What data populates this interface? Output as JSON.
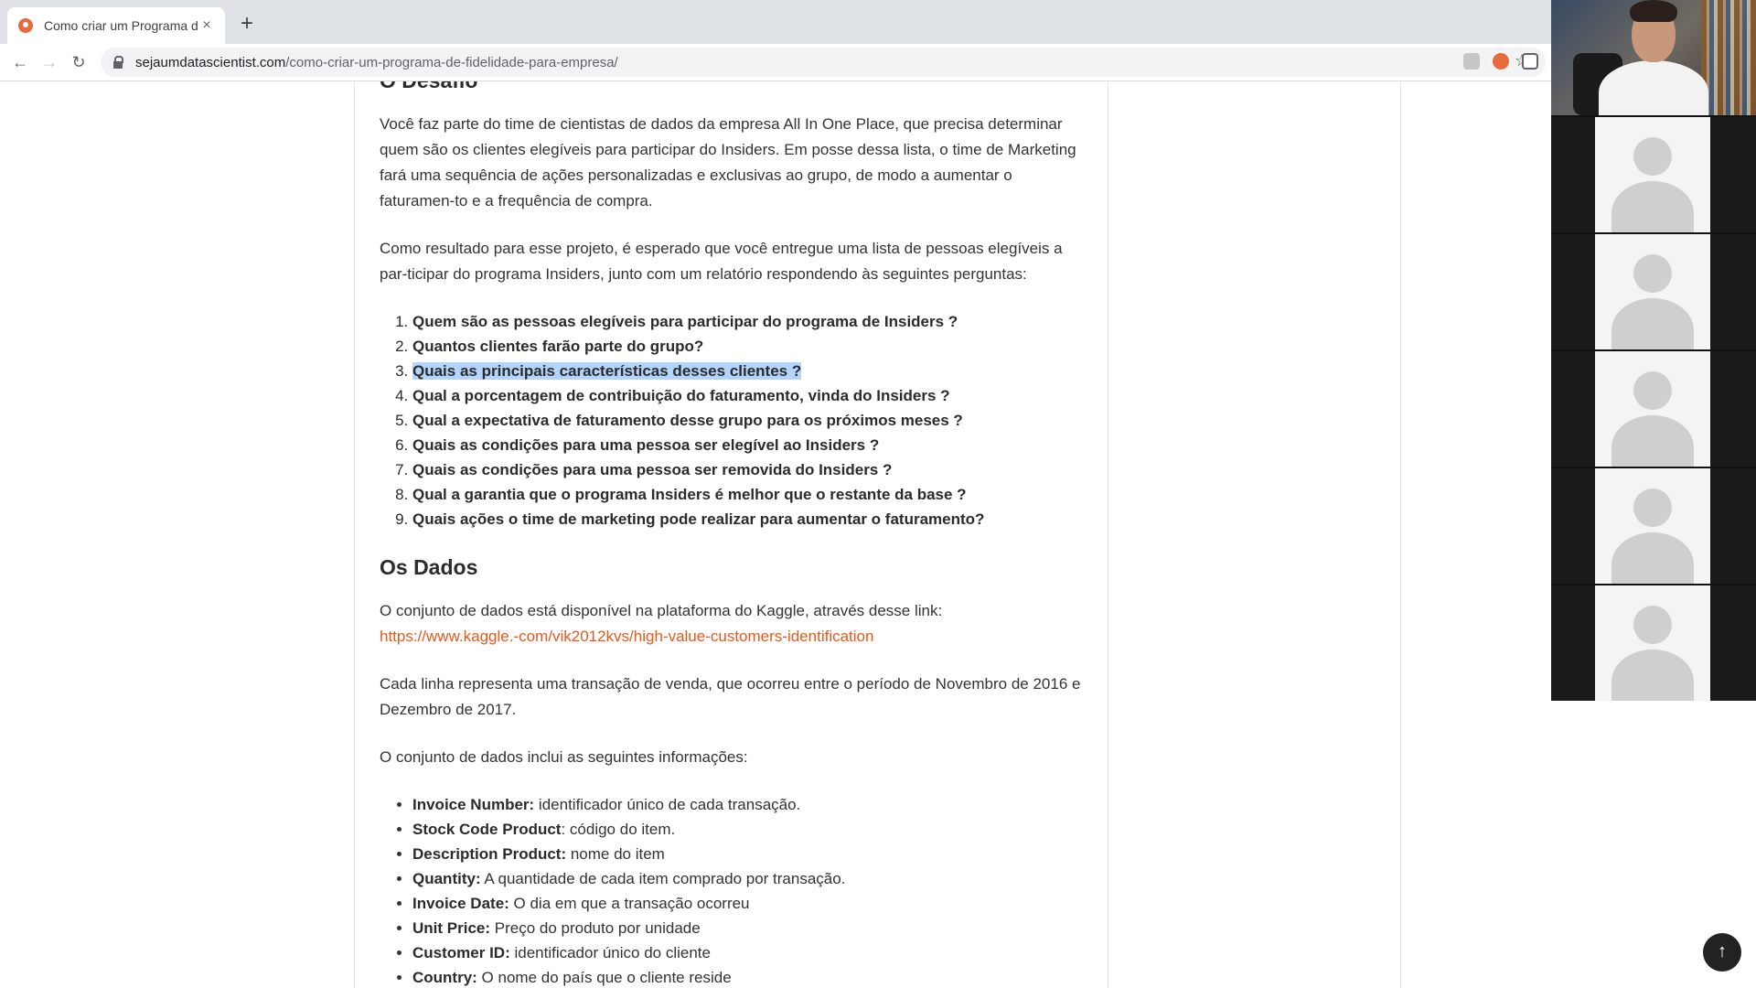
{
  "browser": {
    "tab_title": "Como criar um Programa de Fi",
    "tab_close": "×",
    "new_tab": "+",
    "url_domain": "sejaumdatascientist.com",
    "url_path": "/como-criar-um-programa-de-fidelidade-para-empresa/",
    "back": "←",
    "forward": "→",
    "reload": "↻",
    "star": "☆"
  },
  "article": {
    "challenge_title": "O Desafio",
    "p1": "Você faz parte do time de cientistas de dados da empresa All In One Place, que precisa determinar quem são os clientes elegíveis para participar do Insiders. Em posse dessa lista, o time de Marketing fará uma sequência de ações personalizadas e exclusivas ao grupo, de modo a aumentar o faturamen-to e a frequência de compra.",
    "p2": "Como resultado para esse projeto, é esperado que você entregue uma lista de pessoas elegíveis a par-ticipar do programa Insiders, junto com um relatório respondendo às seguintes perguntas:",
    "questions": [
      "Quem são as pessoas elegíveis para participar do programa de Insiders ?",
      "Quantos clientes farão parte do grupo?",
      "Quais as principais características desses clientes ?",
      "Qual a porcentagem de contribuição do faturamento, vinda do Insiders ?",
      "Qual a expectativa de faturamento desse grupo para os próximos meses ?",
      "Quais as condições para uma pessoa ser elegível ao Insiders ?",
      "Quais as condições para uma pessoa ser removida do Insiders ?",
      "Qual a garantia que o programa Insiders é melhor que o restante da base ?",
      "Quais ações o time de marketing pode realizar para aumentar o faturamento?"
    ],
    "data_title": "Os Dados",
    "p3_text": "O conjunto de dados está disponível na plataforma do Kaggle, através desse link: ",
    "p3_link": "https://www.kaggle.-com/vik2012kvs/high-value-customers-identification",
    "p4": "Cada linha representa uma transação de venda, que ocorreu entre o período de Novembro de 2016 e Dezembro de 2017.",
    "p5": "O conjunto de dados inclui as seguintes informações:",
    "fields": [
      {
        "name": "Invoice Number:",
        "desc": " identificador único de cada transação."
      },
      {
        "name": "Stock Code Product",
        "desc": ": código do item."
      },
      {
        "name": "Description Product:",
        "desc": " nome do item"
      },
      {
        "name": "Quantity:",
        "desc": " A quantidade de cada item comprado por transação."
      },
      {
        "name": "Invoice Date:",
        "desc": " O dia em que a transação ocorreu"
      },
      {
        "name": "Unit Price:",
        "desc": " Preço do produto por unidade"
      },
      {
        "name": "Customer ID:",
        "desc": " identificador único do cliente"
      },
      {
        "name": "Country:",
        "desc": " O nome do país que o cliente reside"
      }
    ]
  },
  "ui": {
    "scroll_top": "↑"
  },
  "colors": {
    "link": "#e35a1b",
    "highlight": "#b3d4fc"
  }
}
